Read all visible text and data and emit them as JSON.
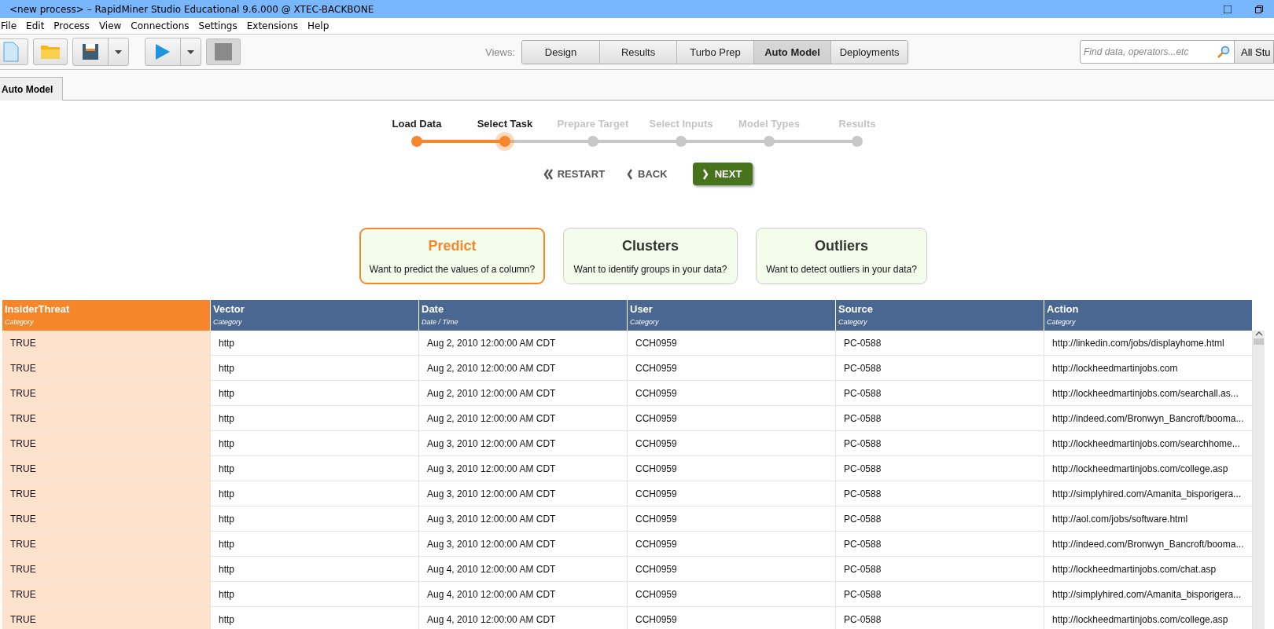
{
  "window": {
    "title": "<new process> – RapidMiner Studio Educational 9.6.000 @ XTEC-BACKBONE"
  },
  "menu": [
    "File",
    "Edit",
    "Process",
    "View",
    "Connections",
    "Settings",
    "Extensions",
    "Help"
  ],
  "views": {
    "label": "Views:",
    "items": [
      {
        "label": "Design",
        "selected": false
      },
      {
        "label": "Results",
        "selected": false
      },
      {
        "label": "Turbo Prep",
        "selected": false
      },
      {
        "label": "Auto Model",
        "selected": true
      },
      {
        "label": "Deployments",
        "selected": false
      }
    ]
  },
  "search": {
    "placeholder": "Find data, operators...etc",
    "scope": "All Stu"
  },
  "panel_tab": {
    "label": "Auto Model"
  },
  "steps": [
    {
      "label": "Load Data",
      "completed": true,
      "selected": false
    },
    {
      "label": "Select Task",
      "completed": true,
      "selected": true
    },
    {
      "label": "Prepare Target",
      "completed": false,
      "selected": false
    },
    {
      "label": "Select Inputs",
      "completed": false,
      "selected": false
    },
    {
      "label": "Model Types",
      "completed": false,
      "selected": false
    },
    {
      "label": "Results",
      "completed": false,
      "selected": false
    }
  ],
  "nav": {
    "restart": "RESTART",
    "back": "BACK",
    "next": "NEXT"
  },
  "tasks": [
    {
      "title": "Predict",
      "description": "Want to predict the values of a column?",
      "selected": true
    },
    {
      "title": "Clusters",
      "description": "Want to identify groups in your data?",
      "selected": false
    },
    {
      "title": "Outliers",
      "description": "Want to detect outliers in your data?",
      "selected": false
    }
  ],
  "table": {
    "columns": [
      {
        "name": "InsiderThreat",
        "type": "Category",
        "selected": true
      },
      {
        "name": "Vector",
        "type": "Category",
        "selected": false
      },
      {
        "name": "Date",
        "type": "Date / Time",
        "selected": false
      },
      {
        "name": "User",
        "type": "Category",
        "selected": false
      },
      {
        "name": "Source",
        "type": "Category",
        "selected": false
      },
      {
        "name": "Action",
        "type": "Category",
        "selected": false
      }
    ],
    "rows": [
      [
        "TRUE",
        "http",
        "Aug 2, 2010 12:00:00 AM CDT",
        "CCH0959",
        "PC-0588",
        "http://linkedin.com/jobs/displayhome.html"
      ],
      [
        "TRUE",
        "http",
        "Aug 2, 2010 12:00:00 AM CDT",
        "CCH0959",
        "PC-0588",
        "http://lockheedmartinjobs.com"
      ],
      [
        "TRUE",
        "http",
        "Aug 2, 2010 12:00:00 AM CDT",
        "CCH0959",
        "PC-0588",
        "http://lockheedmartinjobs.com/searchall.as..."
      ],
      [
        "TRUE",
        "http",
        "Aug 2, 2010 12:00:00 AM CDT",
        "CCH0959",
        "PC-0588",
        "http://indeed.com/Bronwyn_Bancroft/booma..."
      ],
      [
        "TRUE",
        "http",
        "Aug 3, 2010 12:00:00 AM CDT",
        "CCH0959",
        "PC-0588",
        "http://lockheedmartinjobs.com/searchhome..."
      ],
      [
        "TRUE",
        "http",
        "Aug 3, 2010 12:00:00 AM CDT",
        "CCH0959",
        "PC-0588",
        "http://lockheedmartinjobs.com/college.asp"
      ],
      [
        "TRUE",
        "http",
        "Aug 3, 2010 12:00:00 AM CDT",
        "CCH0959",
        "PC-0588",
        "http://simplyhired.com/Amanita_bisporigera..."
      ],
      [
        "TRUE",
        "http",
        "Aug 3, 2010 12:00:00 AM CDT",
        "CCH0959",
        "PC-0588",
        "http://aol.com/jobs/software.html"
      ],
      [
        "TRUE",
        "http",
        "Aug 3, 2010 12:00:00 AM CDT",
        "CCH0959",
        "PC-0588",
        "http://indeed.com/Bronwyn_Bancroft/booma..."
      ],
      [
        "TRUE",
        "http",
        "Aug 4, 2010 12:00:00 AM CDT",
        "CCH0959",
        "PC-0588",
        "http://lockheedmartinjobs.com/chat.asp"
      ],
      [
        "TRUE",
        "http",
        "Aug 4, 2010 12:00:00 AM CDT",
        "CCH0959",
        "PC-0588",
        "http://simplyhired.com/Amanita_bisporigera..."
      ],
      [
        "TRUE",
        "http",
        "Aug 4, 2010 12:00:00 AM CDT",
        "CCH0959",
        "PC-0588",
        "http://lockheedmartinjobs.com/college.asp"
      ]
    ]
  }
}
